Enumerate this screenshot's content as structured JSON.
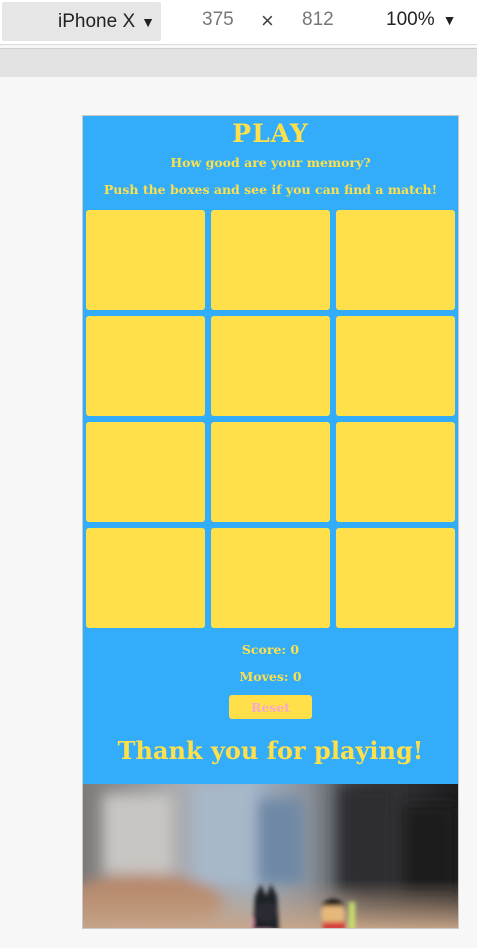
{
  "devtools": {
    "device": "iPhone X",
    "width": "375",
    "times": "×",
    "height": "812",
    "zoom": "100%",
    "caret": "▼"
  },
  "game": {
    "title": "PLAY",
    "question": "How good are your memory?",
    "instruction": "Push the boxes and see if you can find a match!",
    "cards": [
      "",
      "",
      "",
      "",
      "",
      "",
      "",
      "",
      "",
      "",
      "",
      ""
    ],
    "score_label": "Score: 0",
    "moves_label": "Moves: 0",
    "reset_label": "Reset",
    "thanks": "Thank you for playing!"
  },
  "colors": {
    "background": "#33adf9",
    "card": "#ffe04a",
    "text": "#ffe04a",
    "reset_text": "#f4a9c9"
  }
}
